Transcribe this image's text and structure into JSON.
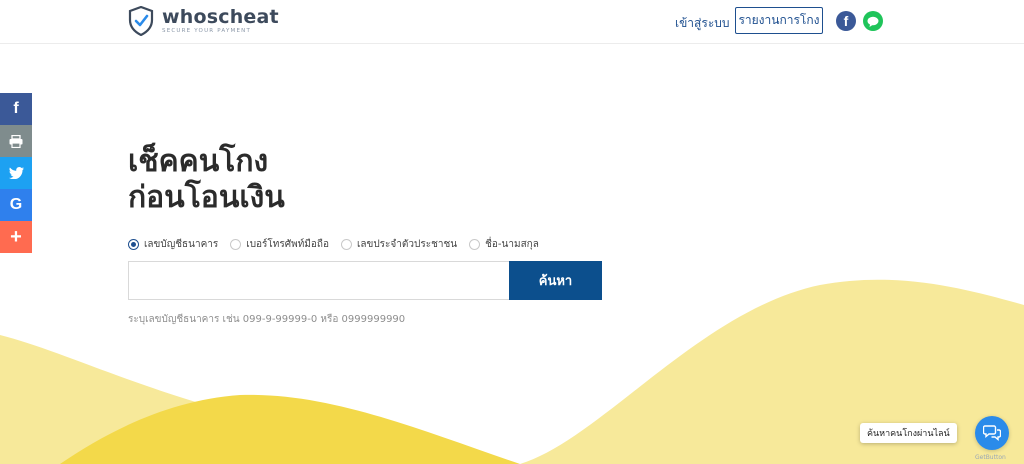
{
  "header": {
    "logo_name": "whoscheat",
    "logo_tagline": "SECURE YOUR PAYMENT",
    "login_label": "เข้าสู่ระบบ",
    "report_label": "รายงานการโกง"
  },
  "share_bar": {
    "items": [
      {
        "icon": "facebook-icon",
        "color": "#3b5998"
      },
      {
        "icon": "print-icon",
        "color": "#7f8c8d"
      },
      {
        "icon": "twitter-icon",
        "color": "#1da1f2"
      },
      {
        "icon": "google-icon",
        "color": "#2f80ed"
      },
      {
        "icon": "plus-icon",
        "color": "#ff6b50"
      }
    ]
  },
  "hero": {
    "title_line1": "เช็คคนโกง",
    "title_line2": "ก่อนโอนเงิน"
  },
  "search": {
    "options": [
      {
        "label": "เลขบัญชีธนาคาร",
        "checked": true
      },
      {
        "label": "เบอร์โทรศัพท์มือถือ",
        "checked": false
      },
      {
        "label": "เลขประจำตัวประชาชน",
        "checked": false
      },
      {
        "label": "ชื่อ-นามสกุล",
        "checked": false
      }
    ],
    "input_value": "",
    "button_label": "ค้นหา",
    "hint": "ระบุเลขบัญชีธนาคาร เช่น 099-9-99999-0 หรือ 0999999990"
  },
  "chat": {
    "label": "ค้นหาคนโกงผ่านไลน์",
    "brand": "GetButton"
  },
  "colors": {
    "primary": "#0c4f8d",
    "wave_light": "#f7e99a",
    "wave_dark": "#f3d94a"
  }
}
